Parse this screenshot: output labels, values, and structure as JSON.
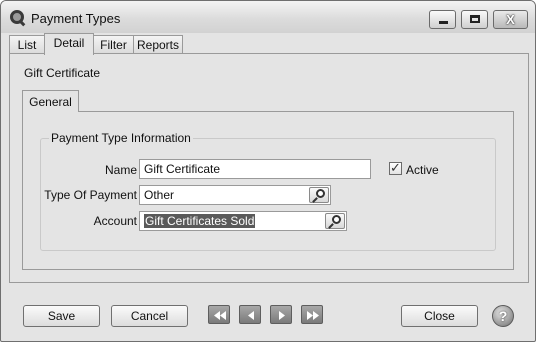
{
  "window": {
    "title": "Payment Types",
    "icon": "magnifier-app-icon",
    "controls": {
      "minimize": "minimize-icon",
      "maximize": "maximize-icon",
      "close_glyph": "X"
    }
  },
  "tabs": [
    {
      "label": "List",
      "active": false
    },
    {
      "label": "Detail",
      "active": true
    },
    {
      "label": "Filter",
      "active": false
    },
    {
      "label": "Reports",
      "active": false
    }
  ],
  "detail": {
    "record_title": "Gift Certificate",
    "inner_tab": "General",
    "group_title": "Payment Type Information",
    "fields": {
      "name": {
        "label": "Name",
        "value": "Gift Certificate"
      },
      "active": {
        "label": "Active",
        "checked": true
      },
      "type_of_payment": {
        "label": "Type Of Payment",
        "value": "Other"
      },
      "account": {
        "label": "Account",
        "value": "Gift Certificates Sold"
      }
    }
  },
  "footer": {
    "save_label": "Save",
    "cancel_label": "Cancel",
    "close_label": "Close",
    "help_glyph": "?",
    "nav": [
      "first-record-icon",
      "previous-record-icon",
      "next-record-icon",
      "last-record-icon"
    ]
  }
}
